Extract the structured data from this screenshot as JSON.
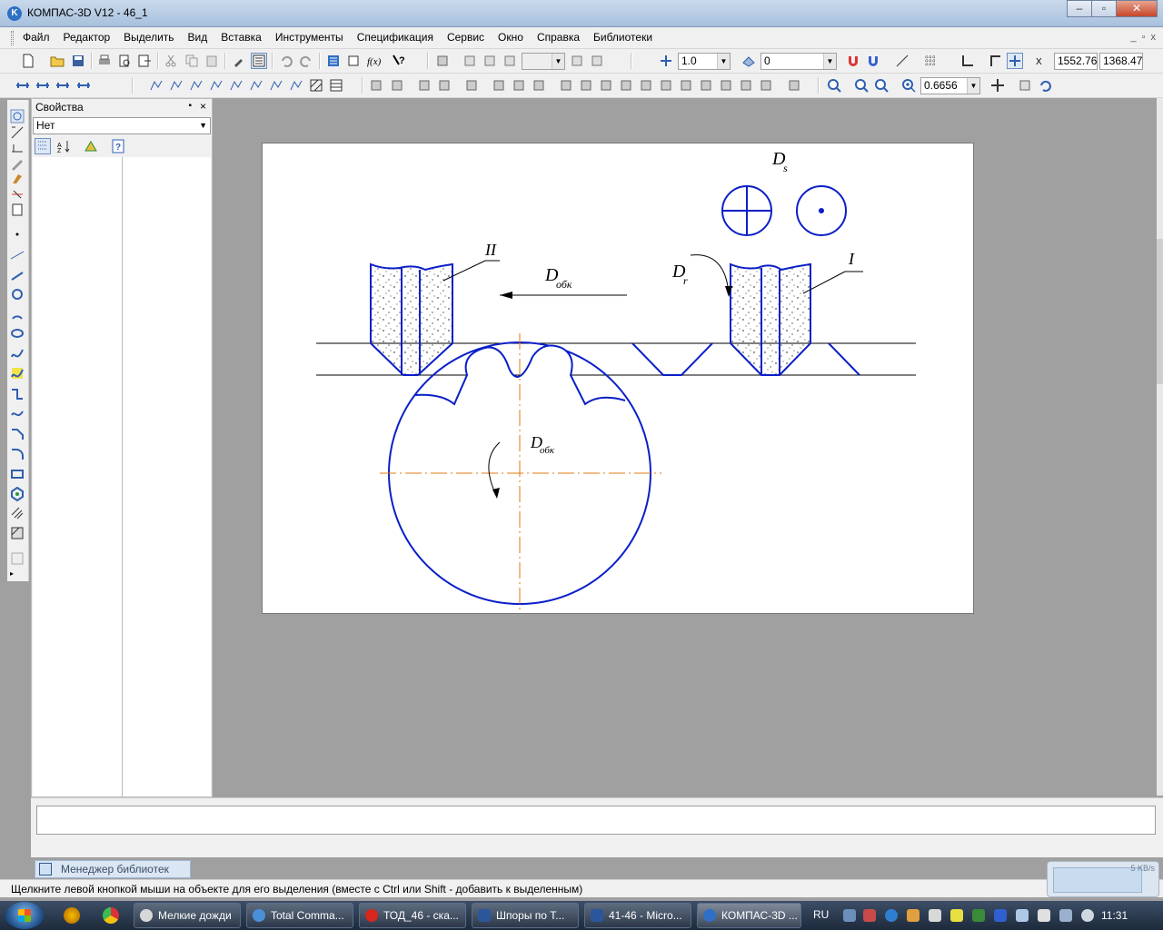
{
  "window": {
    "title": "КОМПАС-3D V12 - 46_1",
    "app_icon_letter": "K",
    "minimize": "‒",
    "maximize": "▫",
    "close": "✕"
  },
  "menu": {
    "items": [
      "Файл",
      "Редактор",
      "Выделить",
      "Вид",
      "Вставка",
      "Инструменты",
      "Спецификация",
      "Сервис",
      "Окно",
      "Справка",
      "Библиотеки"
    ]
  },
  "toolbar": {
    "line_scale": "1.0",
    "layer": "0",
    "coord_x": "1552.76",
    "coord_y": "1368.47",
    "zoom": "0.6656"
  },
  "properties": {
    "title": "Свойства",
    "selected": "Нет"
  },
  "drawing": {
    "label_ds": "D",
    "label_ds_sub": "s",
    "label_dobk": "D",
    "label_dobk_sub": "обк",
    "label_dr": "D",
    "label_dr_sub": "r",
    "label_roman_2": "II",
    "label_roman_1": "I",
    "label_gear_d": "D",
    "label_gear_sub": "обк",
    "colors": {
      "outline": "#0a1fc8",
      "centerline": "#e07a10"
    }
  },
  "library_tab": "Менеджер библиотек",
  "status": "Щелкните левой кнопкой мыши на объекте для его выделения (вместе с Ctrl или Shift - добавить к выделенным)",
  "net_widget": "5 KB/s",
  "taskbar": {
    "tasks": [
      {
        "label": "Мелкие дожди",
        "color": "#d8d8d8"
      },
      {
        "label": "Total Comma...",
        "color": "#4a90d9"
      },
      {
        "label": "ТОД_46 - ска...",
        "color": "#d9261c"
      },
      {
        "label": "Шпоры по Т...",
        "color": "#2b579a"
      },
      {
        "label": "41-46 - Micro...",
        "color": "#2b579a"
      },
      {
        "label": "КОМПАС-3D ...",
        "color": "#2f6fc4"
      }
    ],
    "lang": "RU",
    "clock": "11:31"
  }
}
